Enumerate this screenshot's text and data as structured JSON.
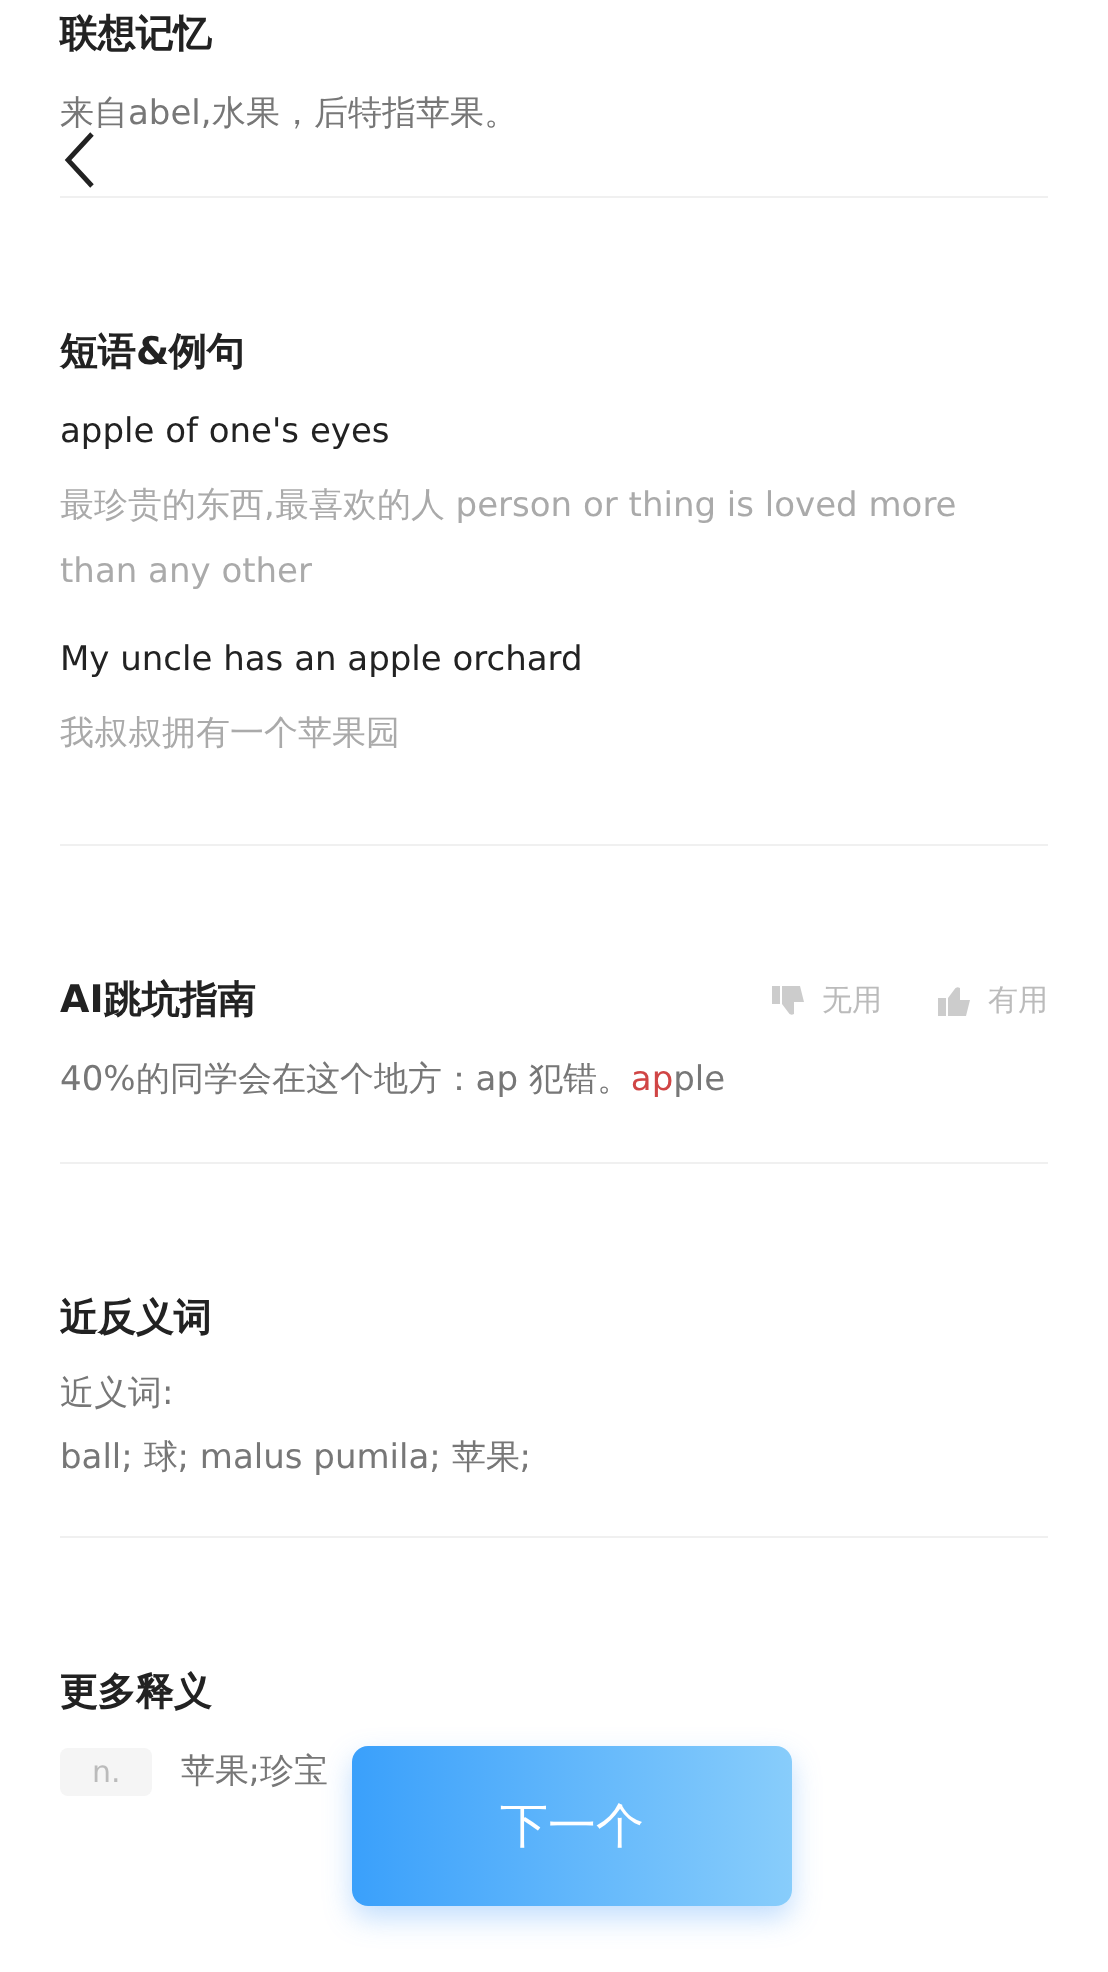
{
  "sections": [
    {
      "kind": "memory",
      "title": "联想记忆",
      "text": "来自abel,水果，后特指苹果。"
    },
    {
      "kind": "phrases",
      "title": "短语&例句",
      "items": [
        {
          "en": "apple of one's eyes",
          "zh": "最珍贵的东西,最喜欢的人 person or thing is loved more than any other"
        },
        {
          "en": "My uncle has an apple orchard",
          "zh": "我叔叔拥有一个苹果园"
        }
      ]
    },
    {
      "kind": "tip",
      "title": "AI跳坑指南",
      "feedback": [
        {
          "label": "无用",
          "kind": "down"
        },
        {
          "label": "有用",
          "kind": "up"
        }
      ],
      "text": "40%的同学会在这个地方：ap 犯错。",
      "word_parts": [
        {
          "text": "ap",
          "highlighted": true
        },
        {
          "text": "ple",
          "highlighted": false
        }
      ]
    },
    {
      "kind": "synonyms",
      "title": "近反义词",
      "label": "近义词:",
      "text": "ball; 球; malus pumila; 苹果;"
    },
    {
      "kind": "more",
      "title": "更多释义",
      "pos": "n.",
      "text": "苹果;珍宝"
    }
  ],
  "next_button": "下一个"
}
